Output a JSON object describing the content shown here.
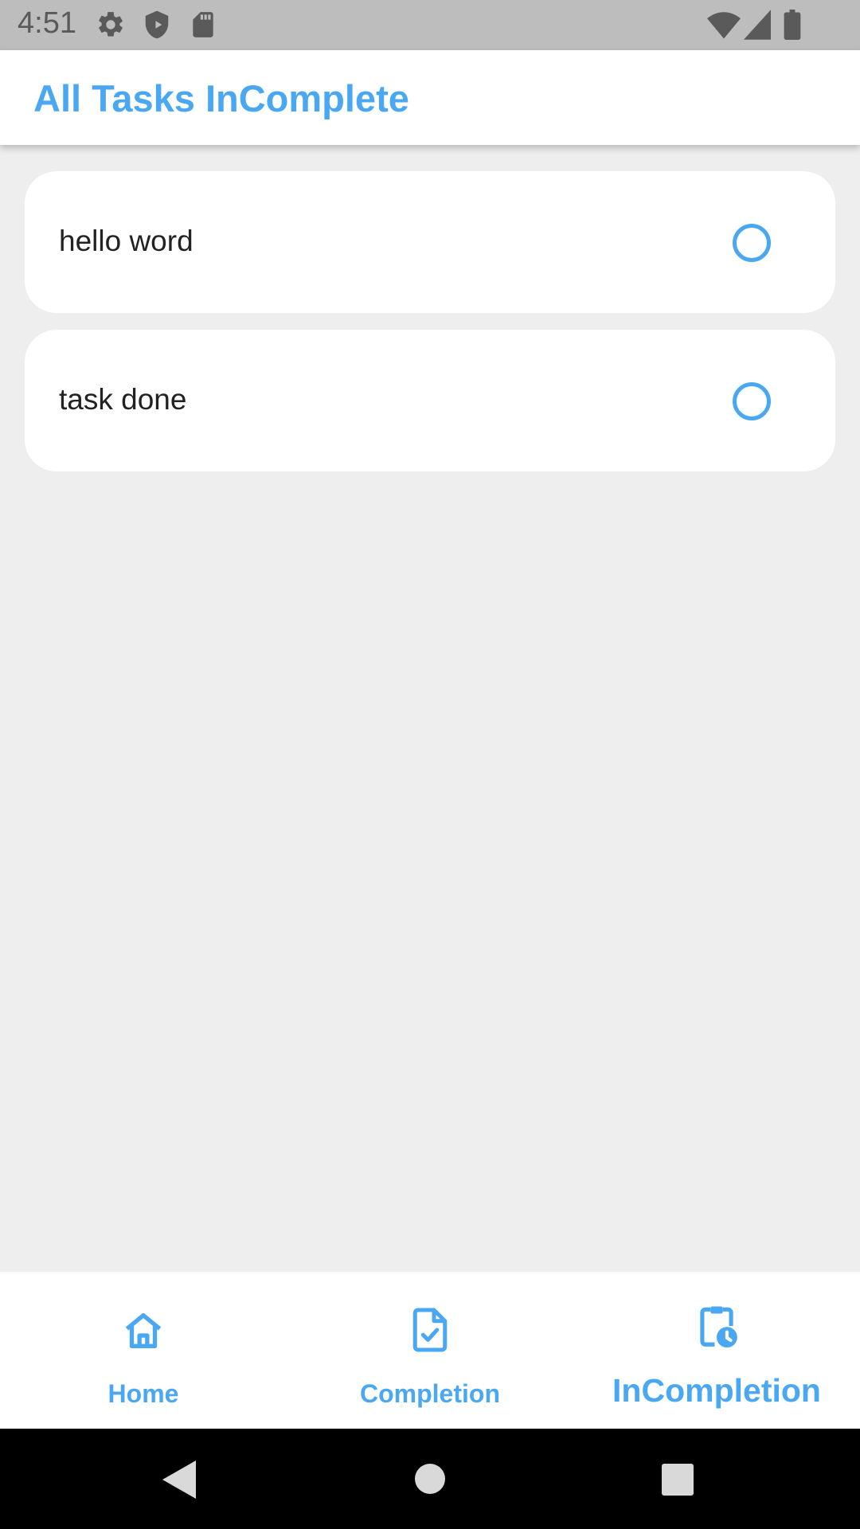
{
  "status_bar": {
    "time": "4:51",
    "left_icons": [
      "gear-icon",
      "shield-icon",
      "sd-card-icon"
    ],
    "right_icons": [
      "wifi-icon",
      "signal-icon",
      "battery-icon"
    ]
  },
  "app_bar": {
    "title": "All Tasks InComplete"
  },
  "tasks": [
    {
      "label": "hello word",
      "completed": false
    },
    {
      "label": "task done",
      "completed": false
    }
  ],
  "bottom_nav": {
    "items": [
      {
        "label": "Home",
        "icon": "home-icon",
        "selected": false
      },
      {
        "label": "Completion",
        "icon": "document-check-icon",
        "selected": false
      },
      {
        "label": "InCompletion",
        "icon": "clipboard-clock-icon",
        "selected": true
      }
    ]
  },
  "system_nav": {
    "icons": [
      "back-icon",
      "home-circle-icon",
      "recents-icon"
    ]
  },
  "colors": {
    "accent": "#4aa8f2",
    "status_bar": "#bdbdbd",
    "background": "#eeeeee",
    "card": "#ffffff",
    "system_nav": "#000000"
  }
}
